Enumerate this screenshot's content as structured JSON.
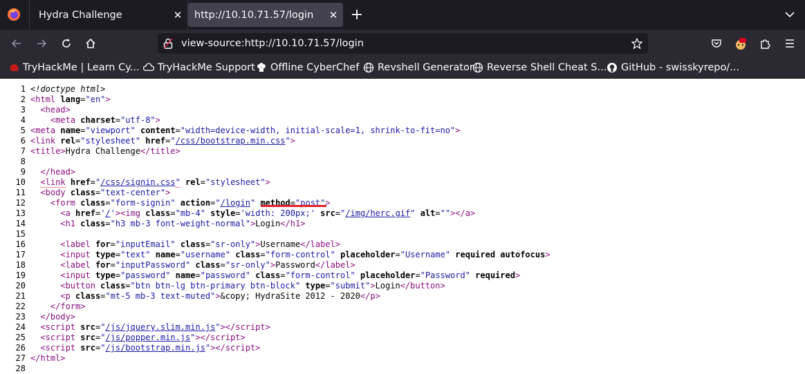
{
  "tabs": [
    {
      "label": "Hydra Challenge",
      "active": false
    },
    {
      "label": "http://10.10.71.57/login",
      "active": true
    }
  ],
  "urlbar": {
    "value": "view-source:http://10.10.71.57/login"
  },
  "bookmarks": [
    {
      "label": "TryHackMe | Learn Cy...",
      "icon": "thm-icon"
    },
    {
      "label": "TryHackMe Support",
      "icon": "cloud-icon"
    },
    {
      "label": "Offline CyberChef",
      "icon": "chef-hat-icon"
    },
    {
      "label": "Revshell Generator",
      "icon": "globe-icon"
    },
    {
      "label": "Reverse Shell Cheat S...",
      "icon": "globe-icon"
    },
    {
      "label": "GitHub - swisskyrepo/...",
      "icon": "github-icon"
    }
  ],
  "source_lines": [
    "1",
    "2",
    "3",
    "4",
    "5",
    "6",
    "7",
    "8",
    "9",
    "10",
    "11",
    "12",
    "13",
    "14",
    "15",
    "16",
    "17",
    "18",
    "19",
    "20",
    "21",
    "22",
    "23",
    "24",
    "25",
    "26",
    "27",
    "28"
  ],
  "colors": {
    "tag": "#8b0e7f",
    "value": "#1a1aa6",
    "accent_underline": "#e3202a"
  }
}
